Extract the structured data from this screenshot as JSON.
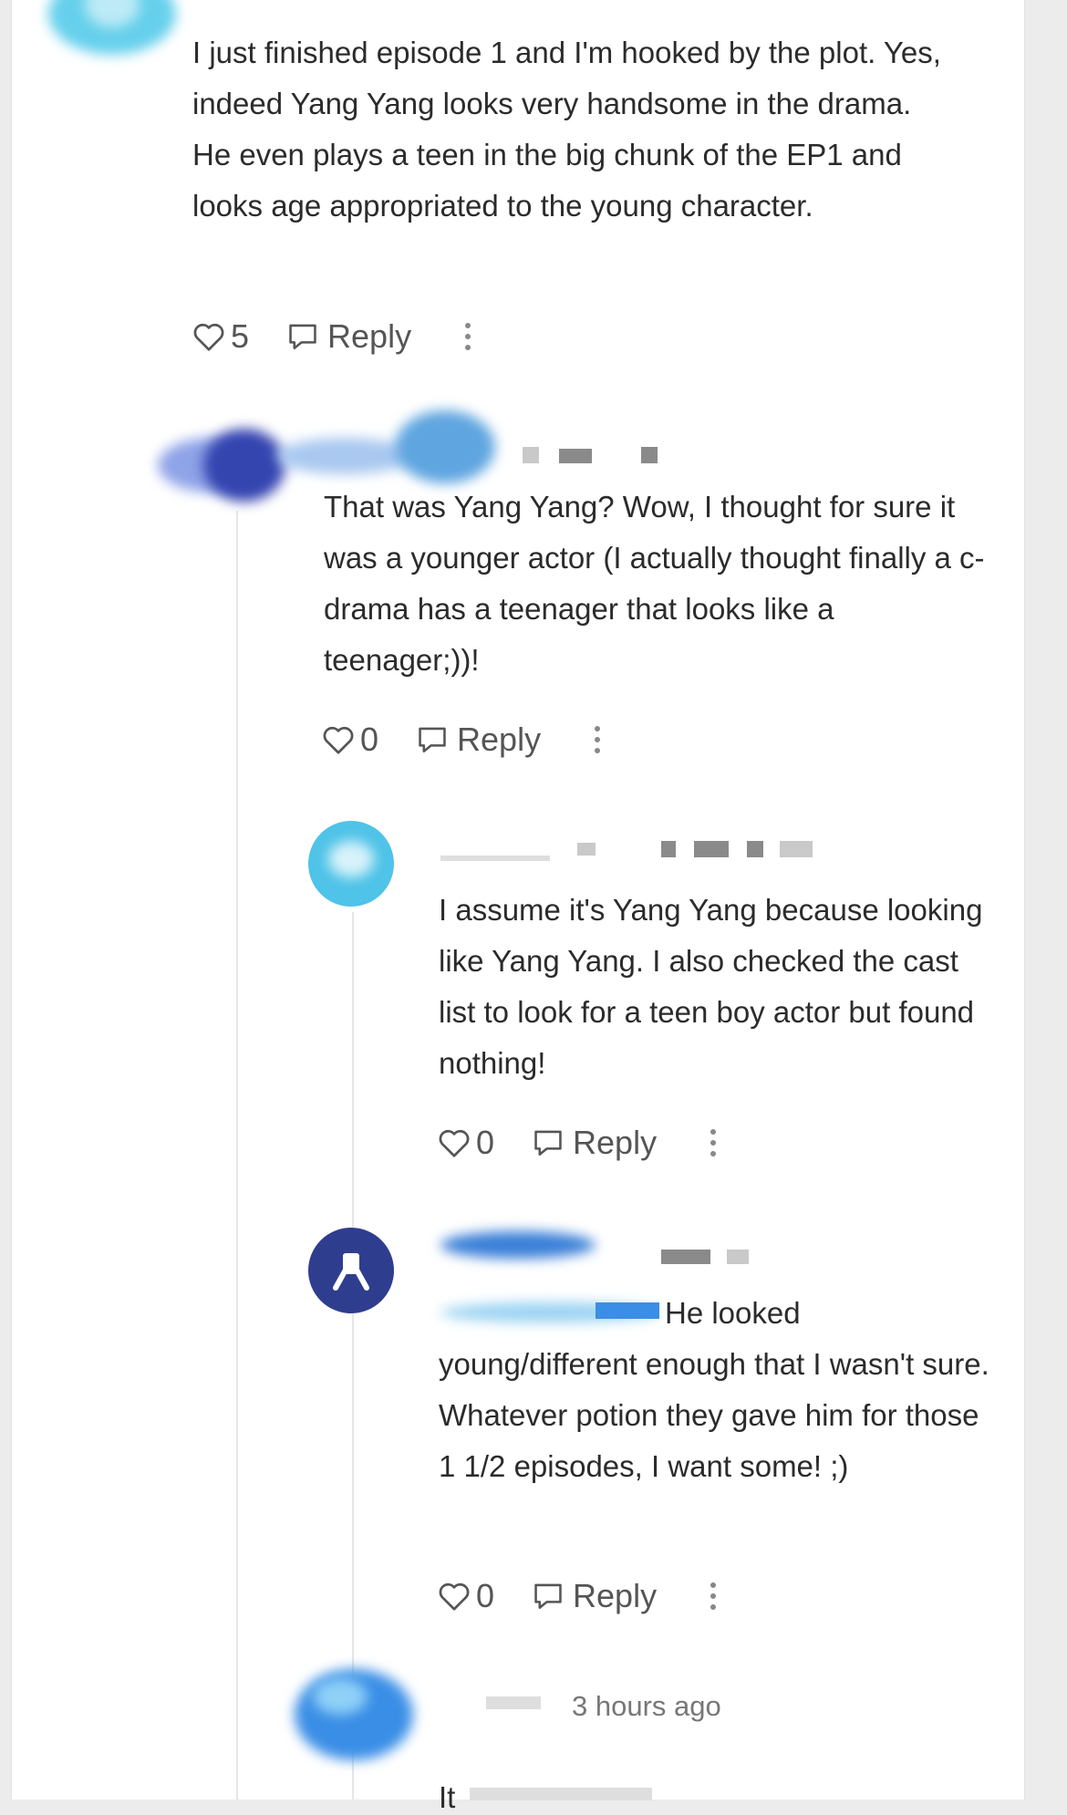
{
  "comments": [
    {
      "text": "I just finished episode 1 and I'm hooked by the plot. Yes, indeed Yang Yang looks very handsome in the drama. He even plays a teen in the big chunk of the EP1 and looks age appropriated to the young character.",
      "likes": "5",
      "reply_label": "Reply"
    },
    {
      "text": "That was Yang Yang? Wow, I thought for sure it was a younger actor (I actually thought finally a c-drama has a teenager that looks like a teenager;))!",
      "likes": "0",
      "reply_label": "Reply"
    },
    {
      "text": "I assume it's Yang Yang because looking like Yang Yang. I also checked the cast list to look for a teen boy actor but found nothing!",
      "likes": "0",
      "reply_label": "Reply"
    },
    {
      "text": "He looked young/different enough that I wasn't sure. Whatever potion they gave him for those 1 1/2 episodes, I want some! ;)",
      "likes": "0",
      "reply_label": "Reply"
    },
    {
      "timestamp": "3 hours ago",
      "text_partial": "It"
    }
  ],
  "colors": {
    "avatar_teal": "#4fc3e8",
    "avatar_navy": "#2f3d8f",
    "avatar_blue": "#3a8ee6"
  },
  "icons": [
    "heart-outline-icon",
    "comment-bubble-icon",
    "more-vertical-icon",
    "user-silhouette-icon"
  ]
}
